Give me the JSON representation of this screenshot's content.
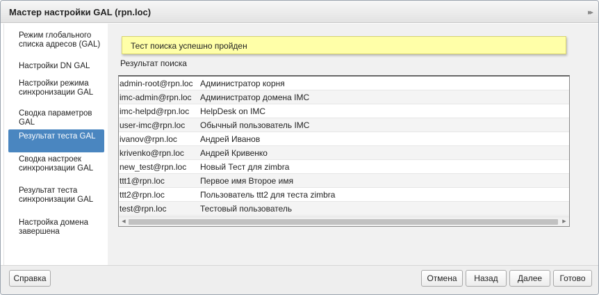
{
  "dialog": {
    "title": "Мастер настройки GAL (rpn.loc)",
    "collapse_icon": "▸▸"
  },
  "sidebar": {
    "steps": [
      {
        "label": "Режим глобального списка адресов (GAL)",
        "active": false
      },
      {
        "label": "Настройки DN GAL",
        "active": false
      },
      {
        "label": "Настройки режима синхронизации GAL",
        "active": false
      },
      {
        "label": "Сводка параметров GAL",
        "active": false
      },
      {
        "label": "Результат теста GAL",
        "active": true
      },
      {
        "label": "Сводка настроек синхронизации GAL",
        "active": false
      },
      {
        "label": "Результат теста синхронизации GAL",
        "active": false
      },
      {
        "label": "Настройка домена завершена",
        "active": false
      }
    ]
  },
  "main": {
    "notice": "Тест поиска успешно пройден",
    "results_label": "Результат поиска",
    "results": [
      {
        "email": "admin-root@rpn.loc",
        "name": "Администратор корня"
      },
      {
        "email": "imc-admin@rpn.loc",
        "name": "Администратор домена IMC"
      },
      {
        "email": "imc-helpd@rpn.loc",
        "name": "HelpDesk on IMC"
      },
      {
        "email": "user-imc@rpn.loc",
        "name": "Обычный пользователь IMC"
      },
      {
        "email": "ivanov@rpn.loc",
        "name": "Андрей Иванов"
      },
      {
        "email": "krivenko@rpn.loc",
        "name": "Андрей Кривенко"
      },
      {
        "email": "new_test@rpn.loc",
        "name": "Новый Тест для zimbra"
      },
      {
        "email": "ttt1@rpn.loc",
        "name": "Первое имя Второе имя"
      },
      {
        "email": "ttt2@rpn.loc",
        "name": "Пользователь ttt2 для теста zimbra"
      },
      {
        "email": "test@rpn.loc",
        "name": "Тестовый пользователь"
      }
    ],
    "scroll_left_icon": "◀",
    "scroll_right_icon": "▶"
  },
  "footer": {
    "help_label": "Справка",
    "cancel_label": "Отмена",
    "back_label": "Назад",
    "next_label": "Далее",
    "finish_label": "Готово"
  },
  "colors": {
    "active_step": "#4a86c0",
    "notice_background": "#ffffa8",
    "content_background": "#f1f1f1"
  }
}
